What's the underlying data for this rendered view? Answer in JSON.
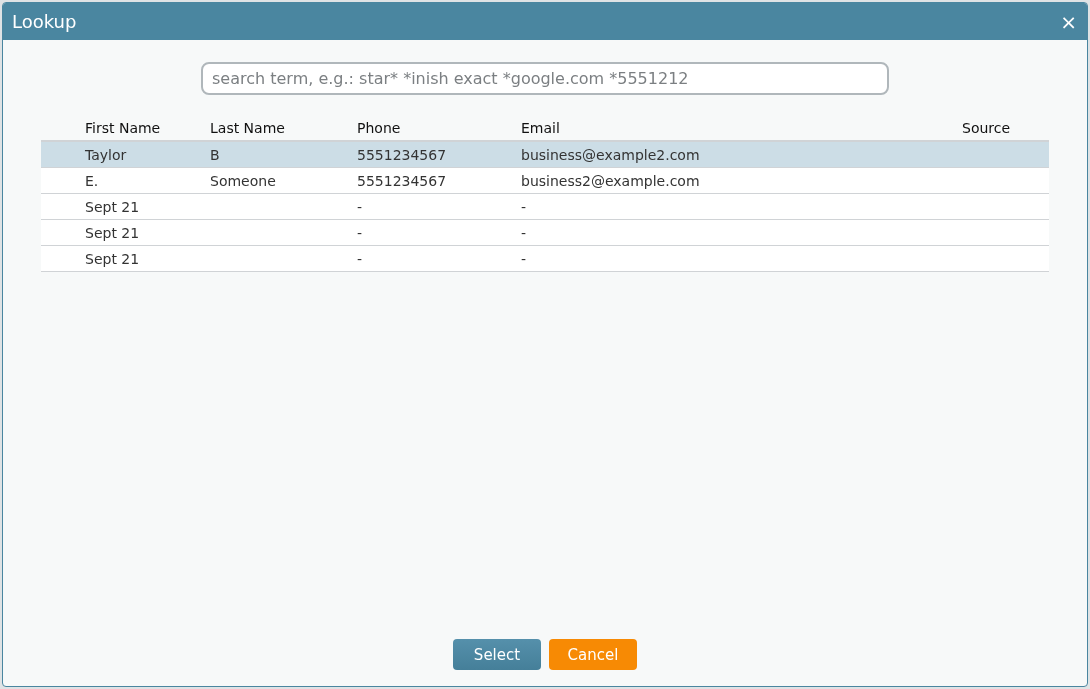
{
  "window": {
    "title": "Lookup",
    "close": "×"
  },
  "search": {
    "placeholder": "search term, e.g.: star* *inish exact *google.com *5551212"
  },
  "table": {
    "columns": [
      "First Name",
      "Last Name",
      "Phone",
      "Email",
      "Source"
    ],
    "rows": [
      {
        "cells": [
          "Taylor",
          "B",
          "5551234567",
          "business@example2.com",
          ""
        ],
        "selected": true
      },
      {
        "cells": [
          "E.",
          "Someone",
          "5551234567",
          "business2@example.com",
          ""
        ],
        "selected": false
      },
      {
        "cells": [
          "Sept 21",
          "",
          "-",
          "-",
          ""
        ],
        "selected": false
      },
      {
        "cells": [
          "Sept 21",
          "",
          "-",
          "-",
          ""
        ],
        "selected": false
      },
      {
        "cells": [
          "Sept 21",
          "",
          "-",
          "-",
          ""
        ],
        "selected": false
      }
    ]
  },
  "buttons": [
    {
      "label": "Select",
      "kind": "primary"
    },
    {
      "label": "Cancel",
      "kind": "cancel"
    }
  ]
}
